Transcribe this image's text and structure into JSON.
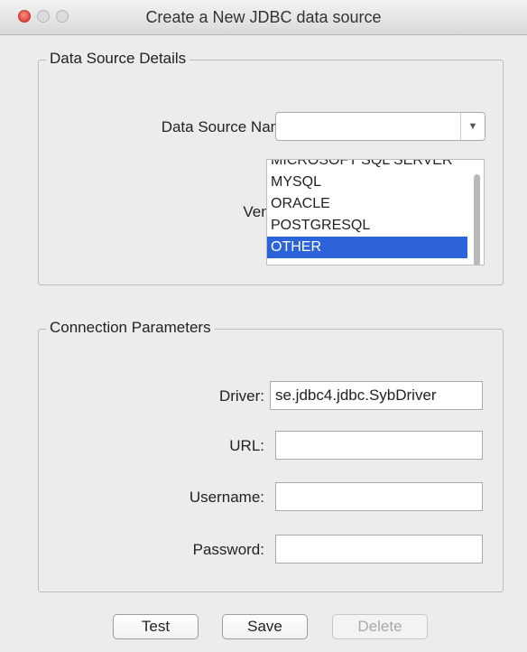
{
  "window": {
    "title": "Create a New JDBC data source"
  },
  "data_source_details": {
    "group_title": "Data Source Details",
    "name_label": "Data Source Name:",
    "name_value": "",
    "vendor_label": "Vendor:",
    "vendors": [
      "MICROSOFT SQL SERVER",
      "MYSQL",
      "ORACLE",
      "POSTGRESQL",
      "OTHER"
    ],
    "selected_vendor": "OTHER"
  },
  "connection_parameters": {
    "group_title": "Connection Parameters",
    "driver_label": "Driver:",
    "driver_value": "se.jdbc4.jdbc.SybDriver",
    "url_label": "URL:",
    "url_value": "",
    "username_label": "Username:",
    "username_value": "",
    "password_label": "Password:",
    "password_value": ""
  },
  "buttons": {
    "test": "Test",
    "save": "Save",
    "delete": "Delete"
  }
}
